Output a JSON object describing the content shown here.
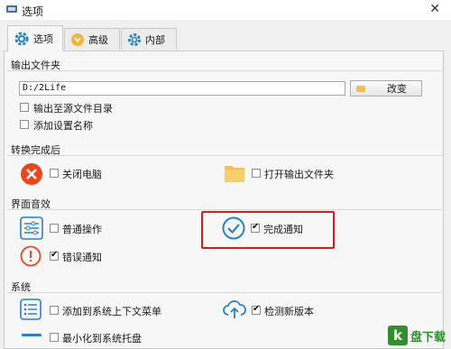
{
  "window": {
    "title": "选项"
  },
  "tabs": [
    {
      "label": "选项",
      "active": true
    },
    {
      "label": "高级",
      "active": false
    },
    {
      "label": "内部",
      "active": false
    }
  ],
  "output_folder": {
    "title": "输出文件夹",
    "path": "D:/2Life",
    "change_label": "改变",
    "options": [
      {
        "label": "输出至源文件目录",
        "checked": false
      },
      {
        "label": "添加设置名称",
        "checked": false
      }
    ]
  },
  "after_convert": {
    "title": "转换完成后",
    "shutdown": {
      "label": "关闭电脑",
      "checked": false
    },
    "open_folder": {
      "label": "打开输出文件夹",
      "checked": false
    }
  },
  "sound": {
    "title": "界面音效",
    "normal": {
      "label": "普通操作",
      "checked": false
    },
    "complete": {
      "label": "完成通知",
      "checked": true
    },
    "error": {
      "label": "错误通知",
      "checked": true
    }
  },
  "system": {
    "title": "系统",
    "context_menu": {
      "label": "添加到系统上下文菜单",
      "checked": false
    },
    "check_update": {
      "label": "检测新版本",
      "checked": true
    },
    "tray": {
      "label": "最小化到系统托盘",
      "checked": false
    }
  },
  "watermark": {
    "text": "盘下载",
    "badge": "k"
  },
  "colors": {
    "accent_blue": "#2a7fd0",
    "error_red": "#e8471e",
    "folder_yellow": "#f4c150",
    "highlight": "#d0201c"
  }
}
